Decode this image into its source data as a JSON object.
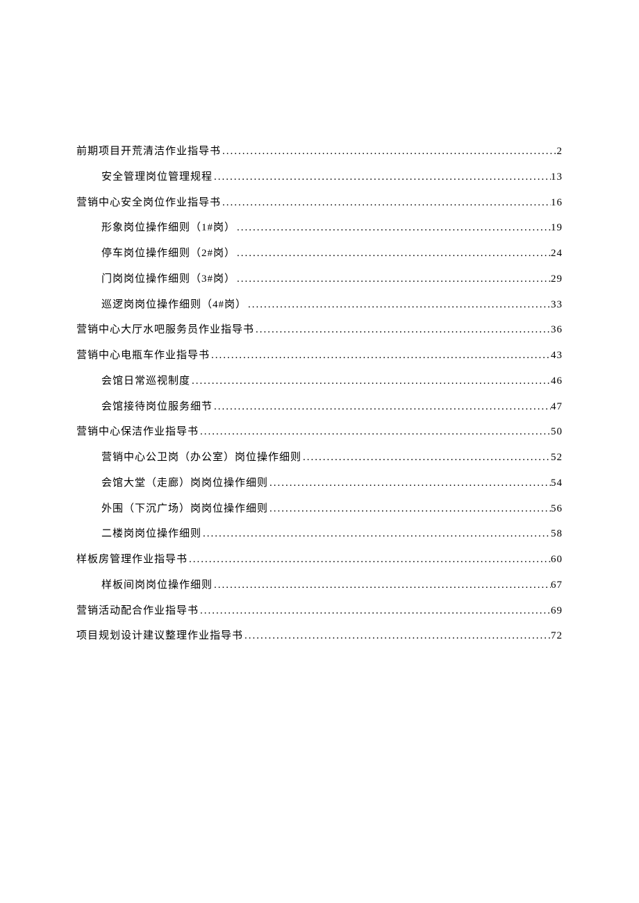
{
  "toc": [
    {
      "level": 1,
      "title": "前期项目开荒清洁作业指导书",
      "page": "2"
    },
    {
      "level": 2,
      "title": "安全管理岗位管理规程",
      "page": "13"
    },
    {
      "level": 1,
      "title": "营销中心安全岗位作业指导书",
      "page": "16"
    },
    {
      "level": 2,
      "title": "形象岗位操作细则（1#岗）",
      "page": "19"
    },
    {
      "level": 2,
      "title": "停车岗位操作细则（2#岗）",
      "page": "24"
    },
    {
      "level": 2,
      "title": "门岗岗位操作细则（3#岗）",
      "page": "29"
    },
    {
      "level": 2,
      "title": "巡逻岗岗位操作细则（4#岗）",
      "page": "33"
    },
    {
      "level": 1,
      "title": "营销中心大厅水吧服务员作业指导书",
      "page": "36"
    },
    {
      "level": 1,
      "title": "营销中心电瓶车作业指导书",
      "page": "43"
    },
    {
      "level": 2,
      "title": "会馆日常巡视制度",
      "page": "46"
    },
    {
      "level": 2,
      "title": "会馆接待岗位服务细节",
      "page": "47"
    },
    {
      "level": 1,
      "title": "营销中心保洁作业指导书",
      "page": "50"
    },
    {
      "level": 2,
      "title": "营销中心公卫岗（办公室）岗位操作细则",
      "page": "52"
    },
    {
      "level": 2,
      "title": "会馆大堂（走廊）岗岗位操作细则",
      "page": "54"
    },
    {
      "level": 2,
      "title": "外围（下沉广场）岗岗位操作细则",
      "page": "56"
    },
    {
      "level": 2,
      "title": "二楼岗岗位操作细则",
      "page": "58"
    },
    {
      "level": 1,
      "title": "样板房管理作业指导书",
      "page": "60"
    },
    {
      "level": 2,
      "title": "样板间岗岗位操作细则",
      "page": "67"
    },
    {
      "level": 1,
      "title": "营销活动配合作业指导书",
      "page": "69"
    },
    {
      "level": 1,
      "title": "项目规划设计建议整理作业指导书",
      "page": "72"
    }
  ]
}
